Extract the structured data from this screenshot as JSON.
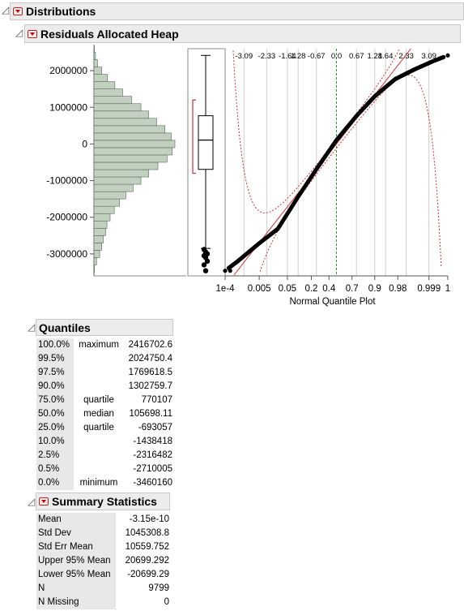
{
  "report": {
    "title": "Distributions",
    "subtitle": "Residuals Allocated Heap"
  },
  "histogram": {
    "y_ticks": [
      "2000000",
      "1000000",
      "0",
      "-1000000",
      "-2000000",
      "-3000000"
    ],
    "y_tick_values": [
      2000000,
      1000000,
      0,
      -1000000,
      -2000000,
      -3000000
    ],
    "bin_edges_start": -3500000,
    "bin_width": 200000,
    "counts": [
      2,
      10,
      22,
      30,
      36,
      45,
      50,
      62,
      78,
      98,
      122,
      150,
      180,
      210,
      245,
      280,
      300,
      310,
      296,
      272,
      240,
      210,
      180,
      145,
      110,
      80,
      52,
      30,
      14,
      6,
      2
    ]
  },
  "boxplot": {
    "median": 105698.11,
    "q1": -693057,
    "q3": 770107,
    "whisker_low": -2850000,
    "whisker_high": 2416702.6,
    "outliers": [
      -2880000,
      -2950000,
      -3000000,
      -3050000,
      -3100000,
      -3200000,
      -3300000,
      -3460160
    ]
  },
  "qq_plot": {
    "xlabel": "Normal Quantile Plot",
    "top_ticks": [
      "-3.09",
      "-2.33",
      "-1.64",
      "1.28",
      "-0.67",
      "0.0",
      "0.67",
      "1.28",
      "1.64",
      "2.33",
      "3.09"
    ],
    "top_tick_values": [
      -3.09,
      -2.33,
      -1.64,
      -1.28,
      -0.67,
      0,
      0.67,
      1.28,
      1.64,
      2.33,
      3.09
    ],
    "bottom_ticks": [
      "1e-4",
      "0.005",
      "0.05",
      "0.2",
      "0.4",
      "0.7",
      "0.9",
      "0.98",
      "0.999",
      "1"
    ],
    "bottom_tick_values": [
      -3.72,
      -2.58,
      -1.64,
      -0.84,
      -0.25,
      0.52,
      1.28,
      2.05,
      3.09,
      3.72
    ]
  },
  "quantiles": {
    "title": "Quantiles",
    "rows": [
      {
        "pct": "100.0%",
        "label": "maximum",
        "value": "2416702.6"
      },
      {
        "pct": "99.5%",
        "label": "",
        "value": "2024750.4"
      },
      {
        "pct": "97.5%",
        "label": "",
        "value": "1769618.5"
      },
      {
        "pct": "90.0%",
        "label": "",
        "value": "1302759.7"
      },
      {
        "pct": "75.0%",
        "label": "quartile",
        "value": "770107"
      },
      {
        "pct": "50.0%",
        "label": "median",
        "value": "105698.11"
      },
      {
        "pct": "25.0%",
        "label": "quartile",
        "value": "-693057"
      },
      {
        "pct": "10.0%",
        "label": "",
        "value": "-1438418"
      },
      {
        "pct": "2.5%",
        "label": "",
        "value": "-2316482"
      },
      {
        "pct": "0.5%",
        "label": "",
        "value": "-2710005"
      },
      {
        "pct": "0.0%",
        "label": "minimum",
        "value": "-3460160"
      }
    ]
  },
  "summary": {
    "title": "Summary Statistics",
    "rows": [
      {
        "label": "Mean",
        "value": "-3.15e-10"
      },
      {
        "label": "Std Dev",
        "value": "1045308.8"
      },
      {
        "label": "Std Err Mean",
        "value": "10559.752"
      },
      {
        "label": "Upper 95% Mean",
        "value": "20699.292"
      },
      {
        "label": "Lower 95% Mean",
        "value": "-20699.29"
      },
      {
        "label": "N",
        "value": "9799"
      },
      {
        "label": "N Missing",
        "value": "0"
      }
    ]
  },
  "colors": {
    "bar_fill": "#c2d0c0",
    "bar_stroke": "#5a6a5a",
    "red_line": "#d03030",
    "green_line": "#2a9a2a",
    "points": "#000000"
  }
}
